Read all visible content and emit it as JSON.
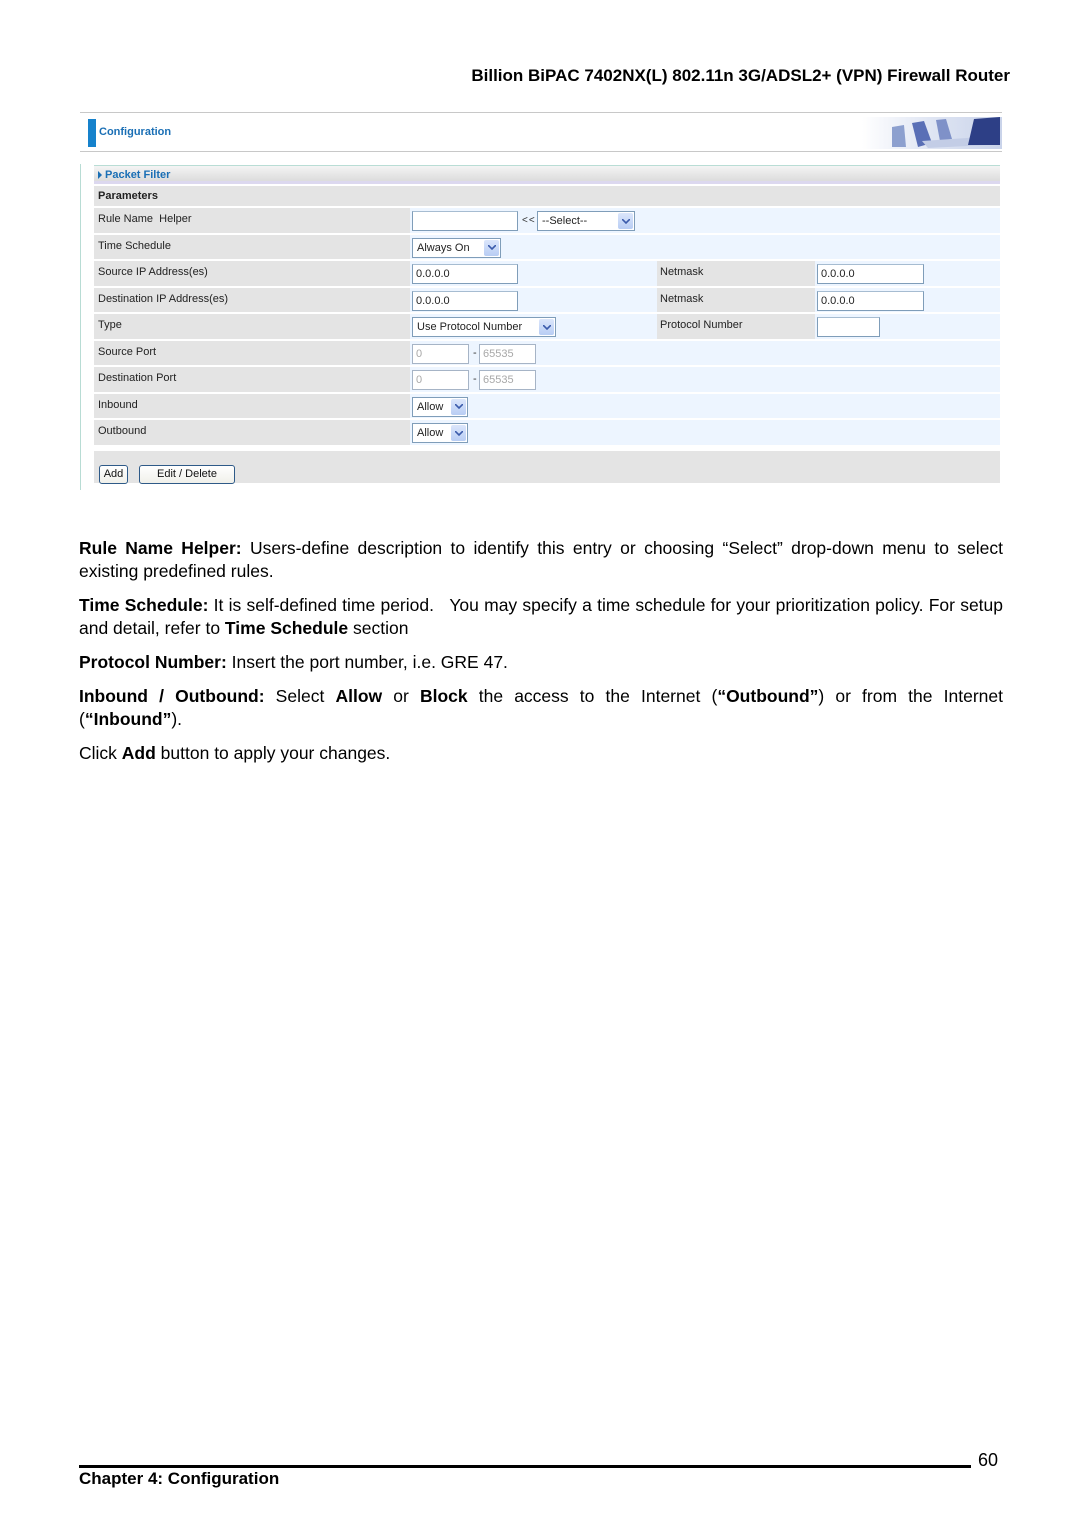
{
  "doc": {
    "header": "Billion BiPAC 7402NX(L) 802.11n 3G/ADSL2+ (VPN) Firewall Router",
    "page_number": "60",
    "chapter": "Chapter 4: Configuration"
  },
  "ui": {
    "title": "Configuration",
    "section": "Packet Filter",
    "parameters_label": "Parameters",
    "rows": {
      "rule_name_helper": {
        "label": "Rule Name  Helper",
        "input_value": "",
        "arrows": "<<",
        "select_value": "--Select--"
      },
      "time_schedule": {
        "label": "Time Schedule",
        "select_value": "Always On"
      },
      "source_ip": {
        "label": "Source IP Address(es)",
        "value": "0.0.0.0",
        "netmask_label": "Netmask",
        "netmask_value": "0.0.0.0"
      },
      "destination_ip": {
        "label": "Destination IP Address(es)",
        "value": "0.0.0.0",
        "netmask_label": "Netmask",
        "netmask_value": "0.0.0.0"
      },
      "type": {
        "label": "Type",
        "select_value": "Use Protocol Number",
        "protocol_label": "Protocol Number",
        "protocol_value": ""
      },
      "source_port": {
        "label": "Source Port",
        "from": "0",
        "sep": "-",
        "to": "65535"
      },
      "destination_port": {
        "label": "Destination Port",
        "from": "0",
        "sep": "-",
        "to": "65535"
      },
      "inbound": {
        "label": "Inbound",
        "select_value": "Allow"
      },
      "outbound": {
        "label": "Outbound",
        "select_value": "Allow"
      }
    },
    "buttons": {
      "add": "Add",
      "edit_delete": "Edit / Delete"
    }
  },
  "text": {
    "p1": {
      "term": "Rule Name Helper:",
      "body": " Users-define description to identify this entry or choosing “Select” drop-down menu to select existing predefined rules."
    },
    "p2": {
      "term": "Time Schedule:",
      "body": " It is self-defined time period.   You may specify a time schedule for your prioritization policy. For setup and detail, refer to ",
      "ref": "Time Schedule",
      "tail": " section"
    },
    "p3": {
      "term": "Protocol Number:",
      "body": " Insert the port number, i.e. GRE 47."
    },
    "p4": {
      "term": "Inbound / Outbound:",
      "s1": " Select ",
      "allow": "Allow",
      "s2": " or ",
      "block": "Block",
      "s3": " the access to the Internet (",
      "outbound": "“Outbound”",
      "s4": ") or from the Internet (",
      "inbound": "“Inbound”",
      "s5": ")."
    },
    "p5": {
      "s1": "Click ",
      "add": "Add",
      "s2": " button to apply your changes."
    }
  }
}
